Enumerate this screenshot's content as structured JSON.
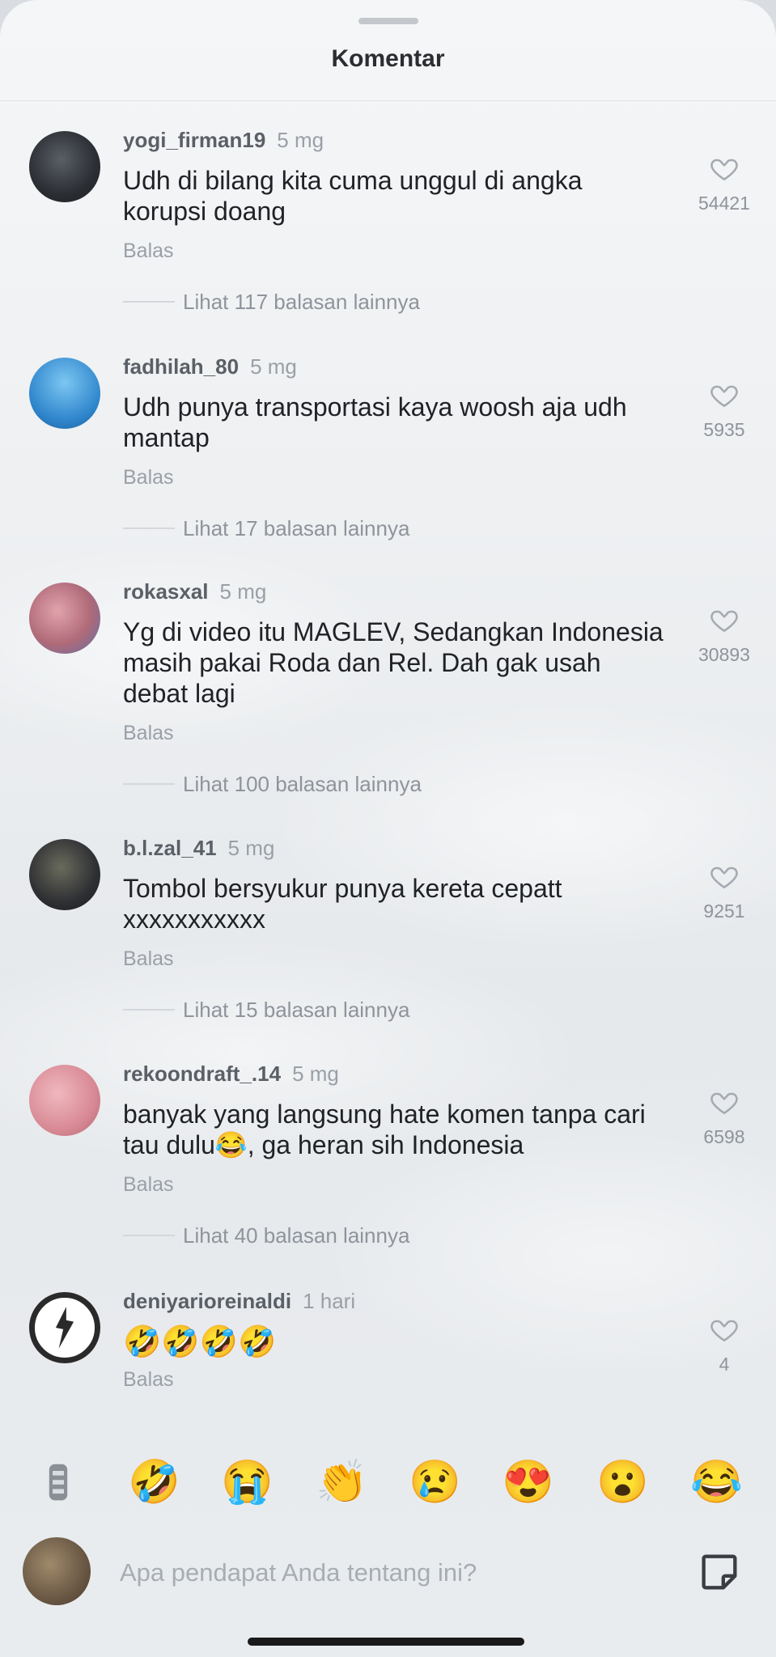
{
  "header": {
    "title": "Komentar"
  },
  "comments": [
    {
      "username": "yogi_firman19",
      "time": "5 mg",
      "text": "Udh di bilang kita cuma unggul di angka korupsi doang",
      "reply_label": "Balas",
      "likes": "54421",
      "view_replies": "Lihat 117 balasan lainnya",
      "avatar_color": "#2b2e33"
    },
    {
      "username": "fadhilah_80",
      "time": "5 mg",
      "text": "Udh punya transportasi kaya woosh aja udh mantap",
      "reply_label": "Balas",
      "likes": "5935",
      "view_replies": "Lihat 17 balasan lainnya",
      "avatar_color": "#3a8fd4"
    },
    {
      "username": "rokasxal",
      "time": "5 mg",
      "text": "Yg di video itu MAGLEV, Sedangkan Indonesia masih pakai Roda dan Rel. Dah gak usah debat lagi",
      "reply_label": "Balas",
      "likes": "30893",
      "view_replies": "Lihat 100 balasan lainnya",
      "avatar_color": "#b06a78"
    },
    {
      "username": "b.l.zal_41",
      "time": "5 mg",
      "text": "Tombol bersyukur punya kereta cepatt xxxxxxxxxxx",
      "reply_label": "Balas",
      "likes": "9251",
      "view_replies": "Lihat 15 balasan lainnya",
      "avatar_color": "#2f3033"
    },
    {
      "username": "rekoondraft_.14",
      "time": "5 mg",
      "text": "banyak yang langsung hate komen tanpa cari tau dulu😂, ga heran sih Indonesia",
      "reply_label": "Balas",
      "likes": "6598",
      "view_replies": "Lihat 40 balasan lainnya",
      "avatar_color": "#d88a95"
    },
    {
      "username": "deniyarioreinaldi",
      "time": "1 hari",
      "text": "🤣🤣🤣🤣",
      "reply_label": "Balas",
      "likes": "4",
      "view_replies": "",
      "avatar_color": "#ffffff"
    }
  ],
  "emoji_bar": [
    "🤣",
    "😭",
    "👏",
    "😢",
    "😍",
    "😮",
    "😂"
  ],
  "input": {
    "placeholder": "Apa pendapat Anda tentang ini?"
  },
  "icons": {
    "like": "heart-outline-icon",
    "sticker": "sticker-icon",
    "gif": "gif-icon"
  }
}
